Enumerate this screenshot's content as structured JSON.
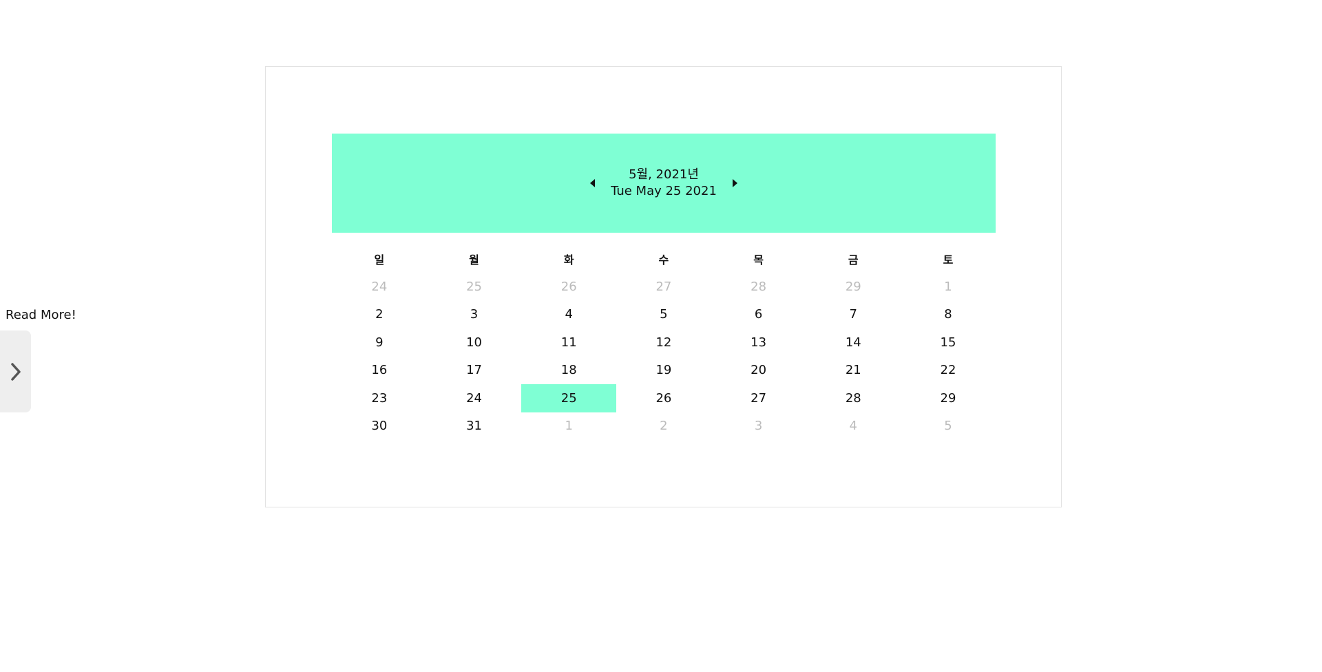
{
  "side_panel": {
    "read_more_label": "Read More!",
    "toggle_icon": "chevron-right-icon"
  },
  "calendar": {
    "month_year": "5월, 2021년",
    "full_date": "Tue May 25 2021",
    "header_color": "#7fffd4",
    "prev_icon": "caret-left-icon",
    "next_icon": "caret-right-icon",
    "weekdays": [
      "일",
      "월",
      "화",
      "수",
      "목",
      "금",
      "토"
    ],
    "weeks": [
      [
        {
          "d": "24",
          "muted": true
        },
        {
          "d": "25",
          "muted": true
        },
        {
          "d": "26",
          "muted": true
        },
        {
          "d": "27",
          "muted": true
        },
        {
          "d": "28",
          "muted": true
        },
        {
          "d": "29",
          "muted": true
        },
        {
          "d": "1",
          "muted": true
        }
      ],
      [
        {
          "d": "2"
        },
        {
          "d": "3"
        },
        {
          "d": "4"
        },
        {
          "d": "5"
        },
        {
          "d": "6"
        },
        {
          "d": "7"
        },
        {
          "d": "8"
        }
      ],
      [
        {
          "d": "9"
        },
        {
          "d": "10"
        },
        {
          "d": "11"
        },
        {
          "d": "12"
        },
        {
          "d": "13"
        },
        {
          "d": "14"
        },
        {
          "d": "15"
        }
      ],
      [
        {
          "d": "16"
        },
        {
          "d": "17"
        },
        {
          "d": "18"
        },
        {
          "d": "19"
        },
        {
          "d": "20"
        },
        {
          "d": "21"
        },
        {
          "d": "22"
        }
      ],
      [
        {
          "d": "23"
        },
        {
          "d": "24"
        },
        {
          "d": "25",
          "selected": true
        },
        {
          "d": "26"
        },
        {
          "d": "27"
        },
        {
          "d": "28"
        },
        {
          "d": "29"
        }
      ],
      [
        {
          "d": "30"
        },
        {
          "d": "31"
        },
        {
          "d": "1",
          "muted": true
        },
        {
          "d": "2",
          "muted": true
        },
        {
          "d": "3",
          "muted": true
        },
        {
          "d": "4",
          "muted": true
        },
        {
          "d": "5",
          "muted": true
        }
      ]
    ]
  }
}
